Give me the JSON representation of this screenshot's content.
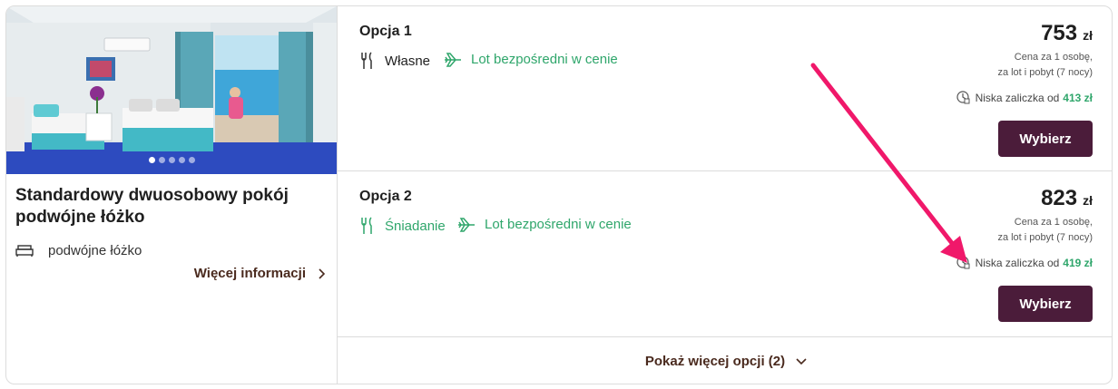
{
  "room": {
    "title": "Standardowy dwuosobowy pokój podwójne łóżko",
    "bed_label": "podwójne łóżko",
    "more_info_label": "Więcej informacji",
    "photo_dots": 5,
    "active_dot": 0
  },
  "options": [
    {
      "title": "Opcja 1",
      "meal": "Własne",
      "flight": "Lot bezpośredni w cenie",
      "price": "753",
      "currency": "zł",
      "price_note_line1": "Cena za 1 osobę,",
      "price_note_line2": "za lot i pobyt (7 nocy)",
      "deposit_label": "Niska zaliczka od",
      "deposit_amount": "413 zł",
      "button_label": "Wybierz"
    },
    {
      "title": "Opcja 2",
      "meal": "Śniadanie",
      "flight": "Lot bezpośredni w cenie",
      "price": "823",
      "currency": "zł",
      "price_note_line1": "Cena za 1 osobę,",
      "price_note_line2": "za lot i pobyt (7 nocy)",
      "deposit_label": "Niska zaliczka od",
      "deposit_amount": "419 zł",
      "button_label": "Wybierz"
    }
  ],
  "show_more_label": "Pokaż więcej opcji (2)",
  "colors": {
    "accent_button": "#4b1c3a",
    "green": "#2fa66b",
    "link_brown": "#4a2a1e",
    "annotation_arrow": "#f0186a"
  },
  "icons": [
    "bed-icon",
    "chevron-right-icon",
    "cutlery-icon",
    "plane-icon",
    "deposit-clock-icon",
    "chevron-down-icon"
  ]
}
